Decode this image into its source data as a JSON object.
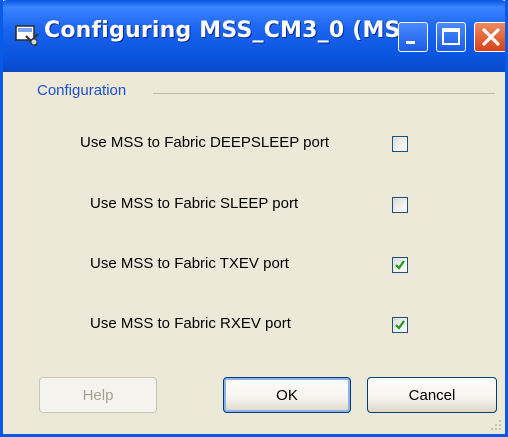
{
  "window": {
    "title": "Configuring MSS_CM3_0 (MS...",
    "app_icon": "configurator-icon",
    "controls": {
      "minimize": "minimize-icon",
      "maximize": "maximize-icon",
      "close": "close-icon"
    }
  },
  "group": {
    "label": "Configuration"
  },
  "options": [
    {
      "label": "Use MSS to Fabric DEEPSLEEP port",
      "checked": false
    },
    {
      "label": "Use MSS to Fabric SLEEP port",
      "checked": false
    },
    {
      "label": "Use MSS to Fabric TXEV port",
      "checked": true
    },
    {
      "label": "Use MSS to Fabric RXEV port",
      "checked": true
    }
  ],
  "buttons": {
    "help": "Help",
    "ok": "OK",
    "cancel": "Cancel"
  },
  "colors": {
    "titlebar": "#0a54e3",
    "dialog": "#ece9d8",
    "group_label": "#1f4fd0",
    "check": "#1d9b1d"
  }
}
